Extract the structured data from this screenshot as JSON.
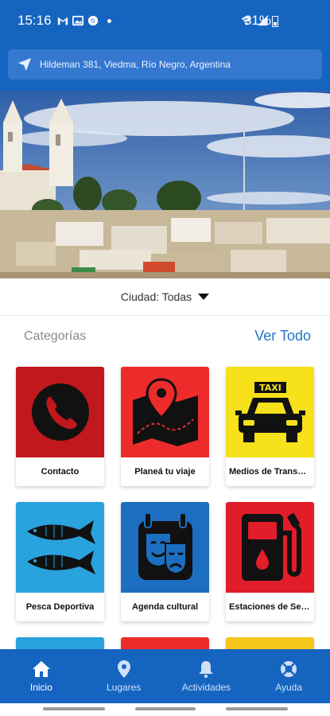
{
  "status_bar": {
    "time": "15:16",
    "battery": "31%",
    "left_icons": [
      "gmail-icon",
      "image-icon",
      "app-icon",
      "dot-icon"
    ],
    "right_icons": [
      "wifi-icon",
      "signal-icon",
      "battery-icon"
    ]
  },
  "location": {
    "address": "Hildeman 381, Viedma, Río Negro, Argentina",
    "icon": "navigation-arrow-icon"
  },
  "city_selector": {
    "label": "Ciudad: Todas"
  },
  "categories": {
    "title": "Categorías",
    "see_all": "Ver Todo",
    "items": [
      {
        "label": "Contacto",
        "icon": "phone-icon",
        "color": "#c0181b"
      },
      {
        "label": "Planeá tu viaje",
        "icon": "map-pin-icon",
        "color": "#ee2b2b"
      },
      {
        "label": "Medios de Transporte",
        "icon": "taxi-icon",
        "color": "#f6e11a"
      },
      {
        "label": "Pesca Deportiva",
        "icon": "fish-icon",
        "color": "#2aa2dd"
      },
      {
        "label": "Agenda cultural",
        "icon": "theater-masks-icon",
        "color": "#1c6fc0"
      },
      {
        "label": "Estaciones de Servicio",
        "icon": "gas-pump-icon",
        "color": "#e11d2a"
      }
    ],
    "partial_colors": [
      "#2aa2dd",
      "#ee2b2b",
      "#f6c61a"
    ]
  },
  "bottom_nav": [
    {
      "label": "Inicio",
      "icon": "home-icon",
      "active": true
    },
    {
      "label": "Lugares",
      "icon": "location-pin-icon",
      "active": false
    },
    {
      "label": "Actividades",
      "icon": "bell-icon",
      "active": false
    },
    {
      "label": "Ayuda",
      "icon": "lifebuoy-icon",
      "active": false
    }
  ],
  "colors": {
    "primary": "#1565c0",
    "link": "#1f74c9"
  }
}
